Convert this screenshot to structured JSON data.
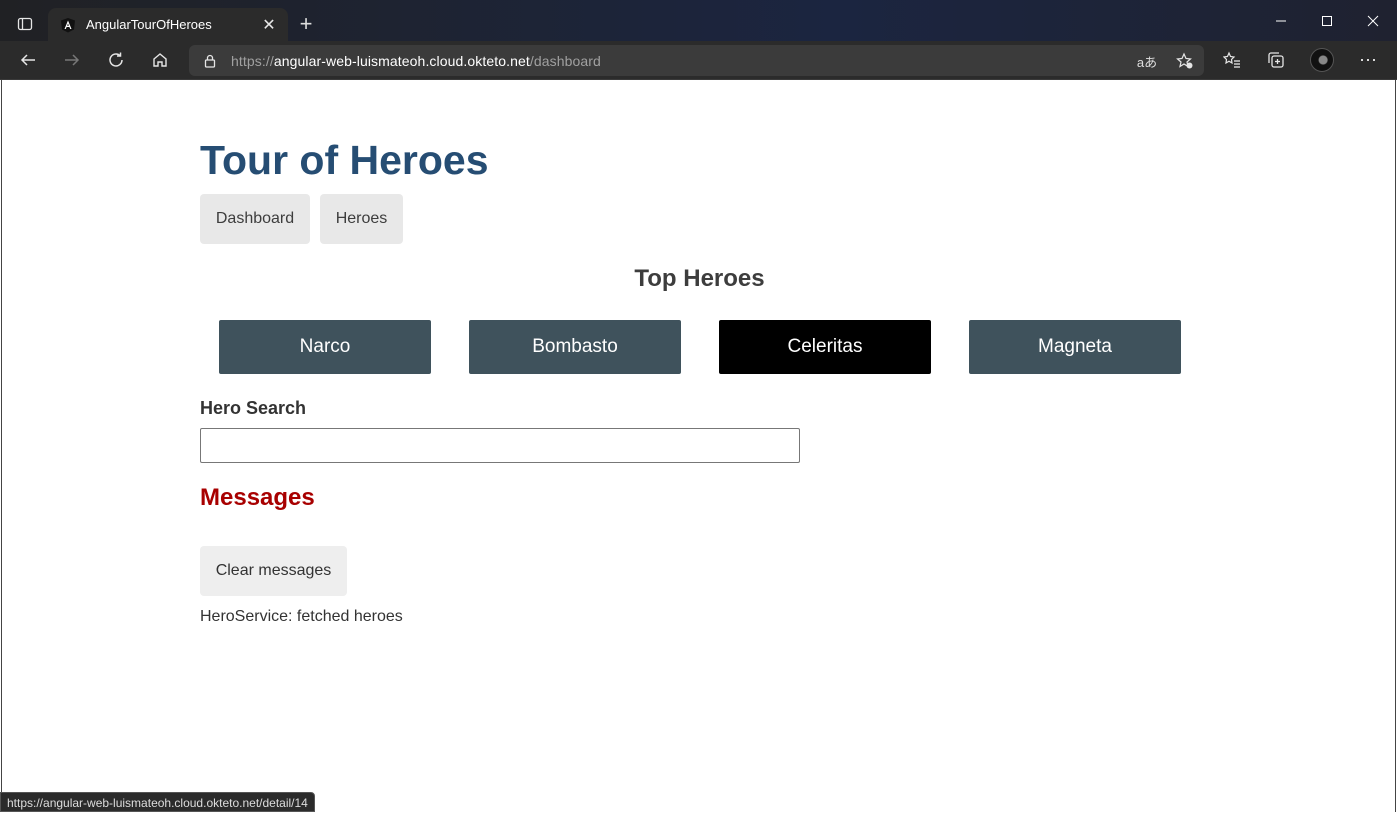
{
  "browser": {
    "tab_title": "AngularTourOfHeroes",
    "url_prefix": "https://",
    "url_host": "angular-web-luismateoh.cloud.okteto.net",
    "url_path": "/dashboard",
    "translate_label": "aあ",
    "status_url": "https://angular-web-luismateoh.cloud.okteto.net/detail/14"
  },
  "app": {
    "title": "Tour of Heroes",
    "nav": [
      "Dashboard",
      "Heroes"
    ]
  },
  "dashboard": {
    "title": "Top Heroes",
    "heroes": [
      {
        "name": "Narco",
        "selected": false
      },
      {
        "name": "Bombasto",
        "selected": false
      },
      {
        "name": "Celeritas",
        "selected": true
      },
      {
        "name": "Magneta",
        "selected": false
      }
    ]
  },
  "search": {
    "label": "Hero Search",
    "value": ""
  },
  "messages": {
    "title": "Messages",
    "clear_label": "Clear messages",
    "items": [
      "HeroService: fetched heroes"
    ]
  }
}
